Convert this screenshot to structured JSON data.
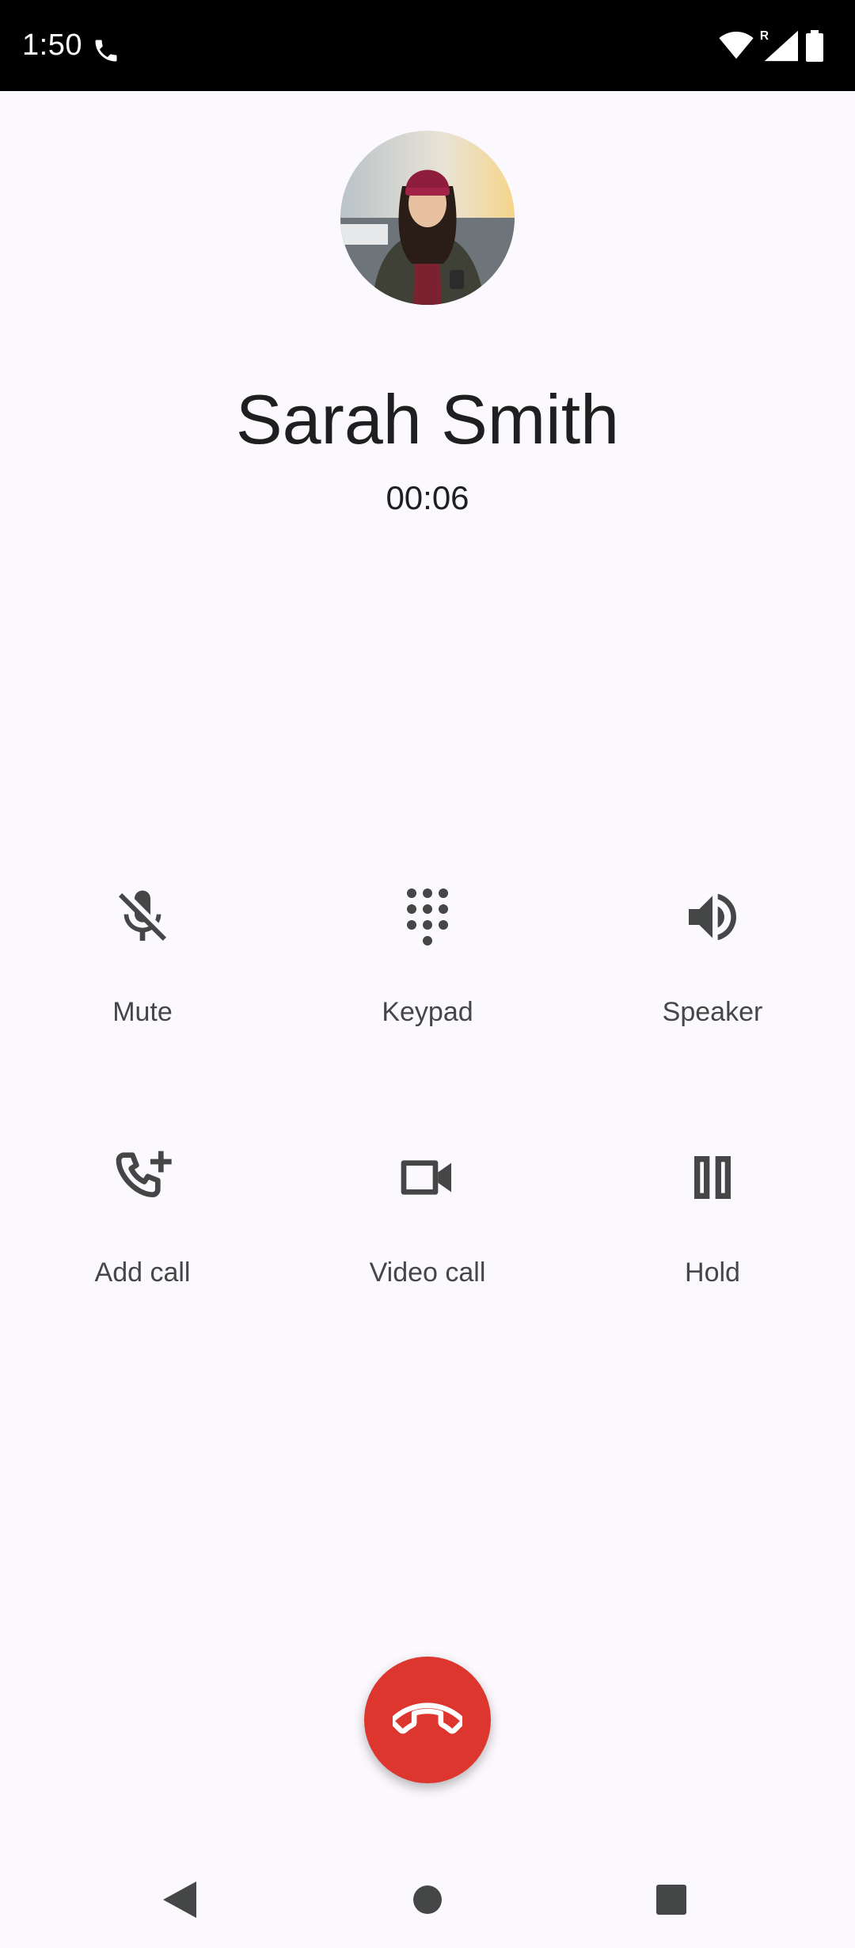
{
  "status_bar": {
    "time": "1:50",
    "icons": [
      "phone-call-icon",
      "wifi-icon",
      "signal-roaming-icon",
      "battery-icon"
    ]
  },
  "caller": {
    "name": "Sarah Smith",
    "timer": "00:06"
  },
  "controls": [
    {
      "label": "Mute",
      "icon": "mic-off-icon"
    },
    {
      "label": "Keypad",
      "icon": "dialpad-icon"
    },
    {
      "label": "Speaker",
      "icon": "speaker-icon"
    },
    {
      "label": "Add call",
      "icon": "add-call-icon"
    },
    {
      "label": "Video call",
      "icon": "video-camera-icon"
    },
    {
      "label": "Hold",
      "icon": "pause-icon"
    }
  ],
  "end_call": {
    "icon": "call-end-icon",
    "color": "#dc362e"
  },
  "nav": {
    "icons": [
      "back-icon",
      "home-icon",
      "recents-icon"
    ]
  },
  "colors": {
    "background": "#fbf9fd",
    "icon": "#444746",
    "end_call": "#dc362e"
  }
}
